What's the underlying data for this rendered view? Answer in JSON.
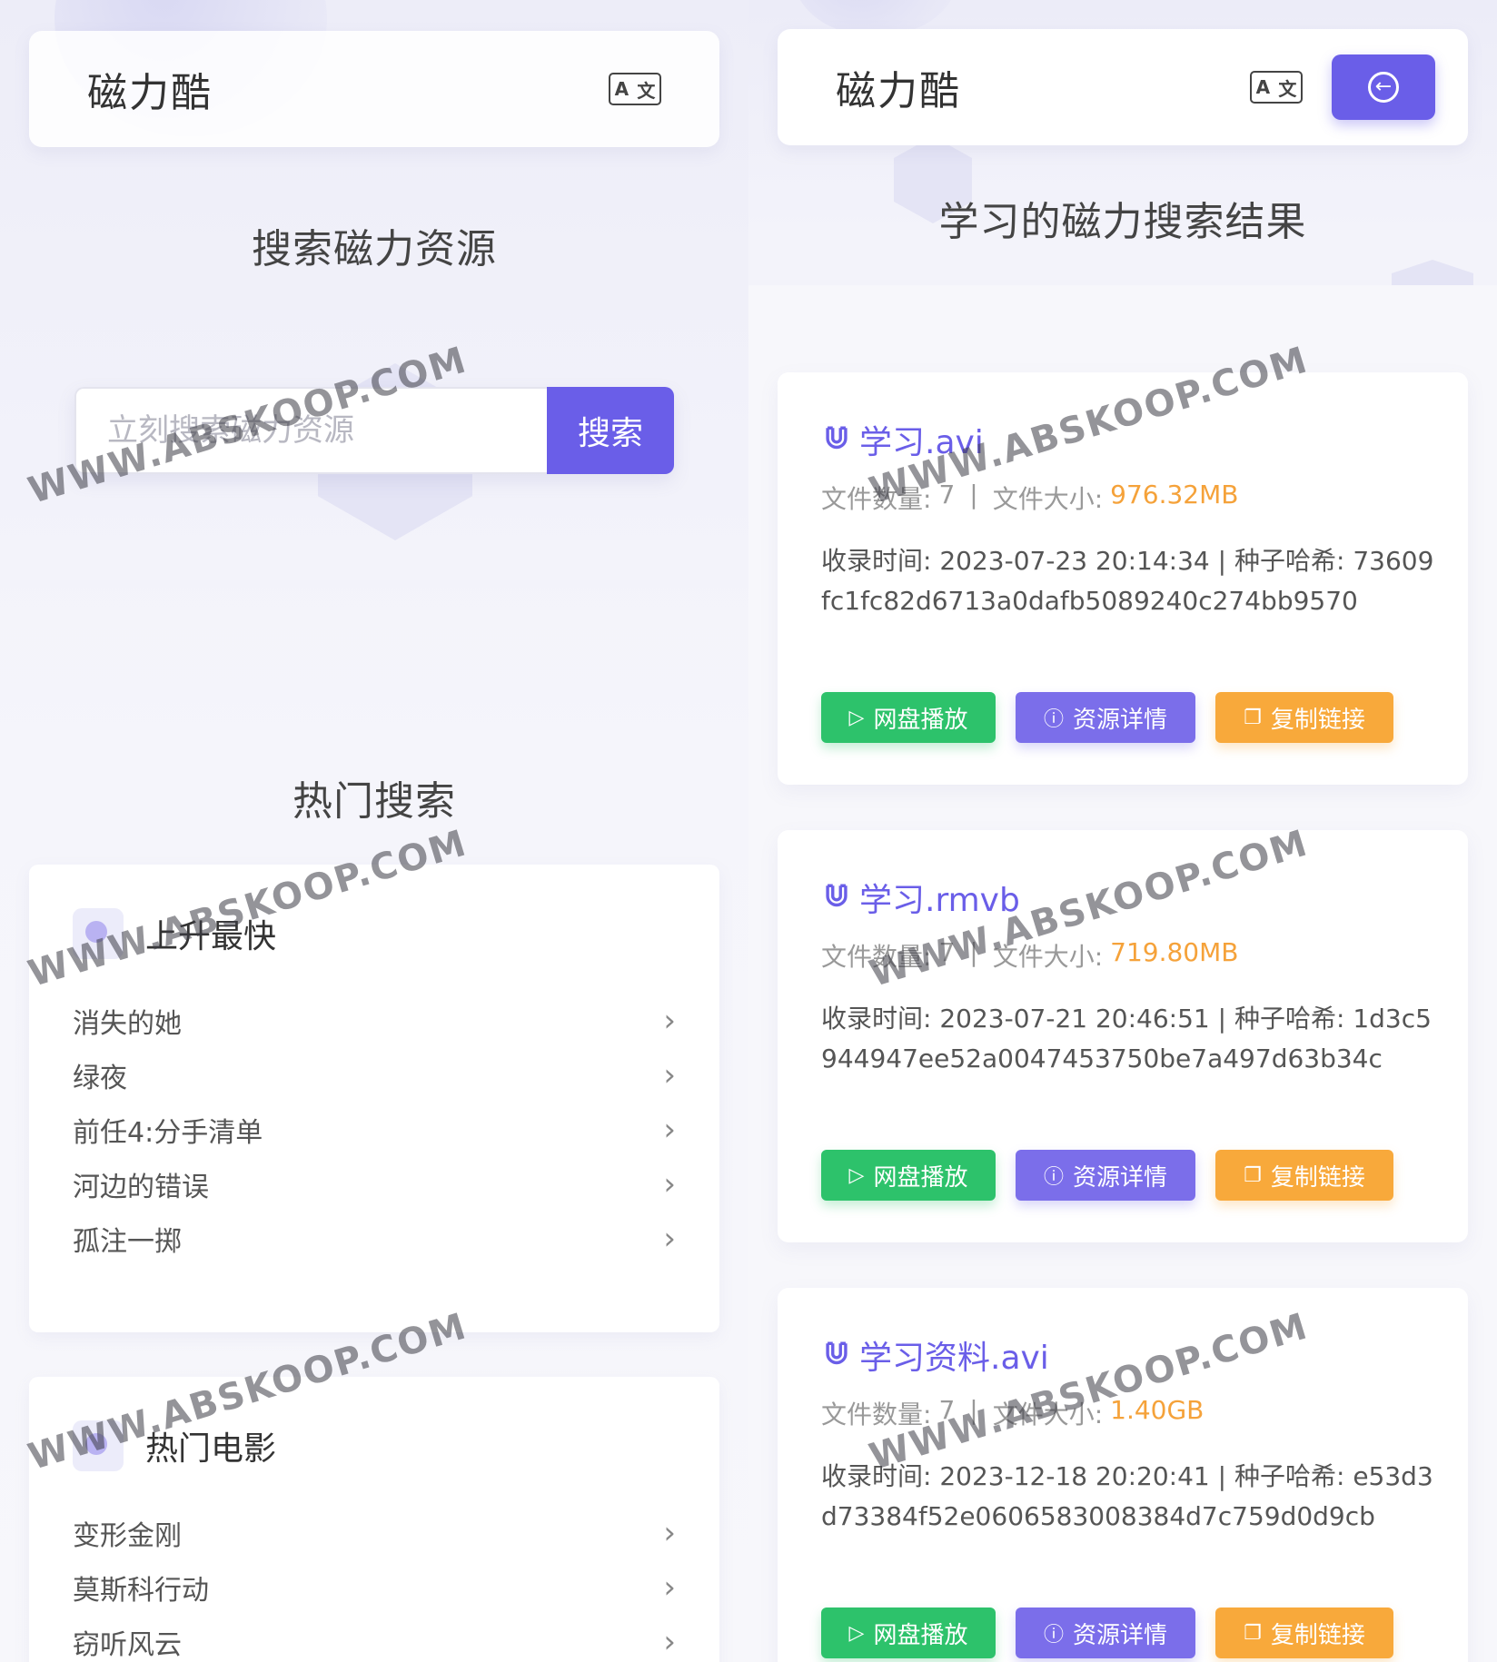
{
  "watermark": "WWW.ABSKOOP.COM",
  "colors": {
    "accent": "#6a5ee8",
    "play": "#2dc26b",
    "info": "#7b6eea",
    "copy": "#f8a93b",
    "size": "#f5a23a"
  },
  "left": {
    "app_title": "磁力酷",
    "translate_icon": {
      "a": "A",
      "zh": "文"
    },
    "search_title": "搜索磁力资源",
    "search": {
      "placeholder": "立刻搜索磁力资源",
      "button": "搜索"
    },
    "hot_title": "热门搜索",
    "groups": [
      {
        "title": "上升最快",
        "items": [
          "消失的她",
          "绿夜",
          "前任4:分手清单",
          "河边的错误",
          "孤注一掷"
        ]
      },
      {
        "title": "热门电影",
        "items": [
          "变形金刚",
          "莫斯科行动",
          "窃听风云"
        ]
      }
    ]
  },
  "right": {
    "app_title": "磁力酷",
    "translate_icon": {
      "a": "A",
      "zh": "文"
    },
    "back_icon": "←",
    "results_title": "学习的磁力搜索结果",
    "labels": {
      "file_count": "文件数量:",
      "file_size": "文件大小:",
      "sep": "|",
      "time": "收录时间:",
      "hash": "种子哈希:"
    },
    "buttons": {
      "play": "网盘播放",
      "detail": "资源详情",
      "copy": "复制链接"
    },
    "results": [
      {
        "name": "学习.avi",
        "count": "7",
        "size": "976.32MB",
        "time": "2023-07-23 20:14:34",
        "hash": "73609fc1fc82d6713a0dafb5089240c274bb9570"
      },
      {
        "name": "学习.rmvb",
        "count": "7",
        "size": "719.80MB",
        "time": "2023-07-21 20:46:51",
        "hash": "1d3c5944947ee52a0047453750be7a497d63b34c"
      },
      {
        "name": "学习资料.avi",
        "count": "7",
        "size": "1.40GB",
        "time": "2023-12-18 20:20:41",
        "hash": "e53d3d73384f52e0606583008384d7c759d0d9cb"
      }
    ]
  }
}
